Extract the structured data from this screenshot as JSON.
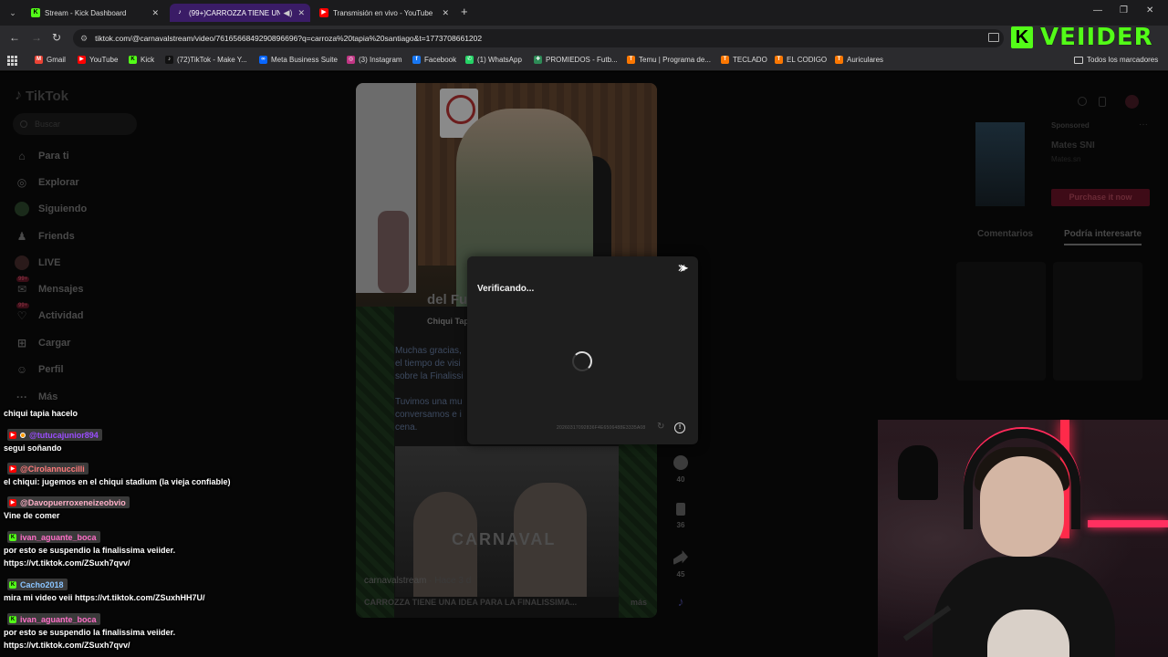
{
  "browser": {
    "tabs": [
      {
        "title": "Stream - Kick Dashboard",
        "favicon": "K",
        "color": "#53fc18",
        "active": false
      },
      {
        "title": "(99+)CARROZZA TIENE UNA",
        "favicon": "♪",
        "color": "#000000",
        "active": true
      },
      {
        "title": "Transmisión en vivo - YouTube",
        "favicon": "▶",
        "color": "#ff0000",
        "active": false
      }
    ],
    "url": "tiktok.com/@carnavalstream/video/7616566849290896696?q=carroza%20tapia%20santiago&t=1773708661202",
    "bookmarks": [
      {
        "label": "Gmail",
        "icon": "M",
        "color": "#ea4335"
      },
      {
        "label": "YouTube",
        "icon": "▶",
        "color": "#ff0000"
      },
      {
        "label": "Kick",
        "icon": "K",
        "color": "#53fc18"
      },
      {
        "label": "(72)TikTok - Make Y...",
        "icon": "♪",
        "color": "#111111"
      },
      {
        "label": "Meta Business Suite",
        "icon": "∞",
        "color": "#0866ff"
      },
      {
        "label": "(3) Instagram",
        "icon": "◎",
        "color": "#c13584"
      },
      {
        "label": "Facebook",
        "icon": "f",
        "color": "#1877f2"
      },
      {
        "label": "(1) WhatsApp",
        "icon": "✆",
        "color": "#25d366"
      },
      {
        "label": "PROMIEDOS - Futb...",
        "icon": "✚",
        "color": "#2e8b57"
      },
      {
        "label": "Temu | Programa de...",
        "icon": "T",
        "color": "#fb7701"
      },
      {
        "label": "TECLADO",
        "icon": "T",
        "color": "#fb7701"
      },
      {
        "label": "EL CODIGO",
        "icon": "T",
        "color": "#fb7701"
      },
      {
        "label": "Auriculares",
        "icon": "T",
        "color": "#fb7701"
      }
    ],
    "all_bookmarks": "Todos los marcadores"
  },
  "tiktok": {
    "logo": "TikTok",
    "search_placeholder": "Buscar",
    "nav": [
      {
        "label": "Para ti",
        "icon": "home-icon"
      },
      {
        "label": "Explorar",
        "icon": "compass-icon"
      },
      {
        "label": "Siguiendo",
        "icon": "following-icon"
      },
      {
        "label": "Friends",
        "icon": "friends-icon"
      },
      {
        "label": "LIVE",
        "icon": "live-icon"
      },
      {
        "label": "Mensajes",
        "icon": "messages-icon",
        "badge": "99+"
      },
      {
        "label": "Actividad",
        "icon": "activity-icon",
        "badge": "99+"
      },
      {
        "label": "Cargar",
        "icon": "upload-icon"
      },
      {
        "label": "Perfil",
        "icon": "profile-icon"
      },
      {
        "label": "Más",
        "icon": "more-icon"
      }
    ],
    "video": {
      "brand_strip": "del Fu",
      "card_author": "Chiqui Tap",
      "card_lines": [
        "Muchas gracias,",
        "el tiempo de visi",
        "sobre la Finalissi",
        "",
        "Tuvimos una mu",
        "conversamos e i",
        "cena."
      ],
      "watermark": "CARNAVAL",
      "author": "carnavalstream",
      "ago": "Hace 3 d",
      "caption": "CARROZZA TIENE UNA IDEA PARA LA FINALISSIMA...",
      "more": "más"
    },
    "actions": [
      {
        "icon": "comment-icon",
        "count": "40"
      },
      {
        "icon": "save-icon",
        "count": "36"
      },
      {
        "icon": "share-icon",
        "count": "45"
      }
    ],
    "ad": {
      "sponsored": "Sponsored",
      "title": "Mates SNI",
      "sub": "Mates.sn",
      "cta": "Purchase it now"
    },
    "tabs": [
      "Comentarios",
      "Podría interesarte"
    ]
  },
  "captcha": {
    "title": "Verificando...",
    "token": "20260317092836F4E6506488E3335A08"
  },
  "chat": [
    {
      "type": "msg",
      "text": "chiqui tapia hacelo"
    },
    {
      "type": "user",
      "name": "@tutucajunior894",
      "badge": "yt",
      "color": "#9b4dff"
    },
    {
      "type": "msg",
      "text": "segui soñando"
    },
    {
      "type": "user",
      "name": "@Cirolannuccilli",
      "badge": "yt",
      "color": "#ff6b6b"
    },
    {
      "type": "msg",
      "text": "el chiqui: jugemos en el chiqui stadium (la vieja confiable)"
    },
    {
      "type": "user",
      "name": "@Davopuerroxeneizeobvio",
      "badge": "yt",
      "color": "#ff8fb0"
    },
    {
      "type": "msg",
      "text": "Vine de comer"
    },
    {
      "type": "user",
      "name": "ivan_aguante_boca",
      "badge": "kick",
      "color": "#ff5fbf"
    },
    {
      "type": "msg",
      "text": "por esto se suspendio la finalissima veiider."
    },
    {
      "type": "msg",
      "text": "https://vt.tiktok.com/ZSuxh7qvv/"
    },
    {
      "type": "user",
      "name": "Cacho2018",
      "badge": "kick",
      "color": "#7ab8ff"
    },
    {
      "type": "msg",
      "text": "mira mi video veii https://vt.tiktok.com/ZSuxhHH7U/"
    },
    {
      "type": "user",
      "name": "ivan_aguante_boca",
      "badge": "kick",
      "color": "#ff5fbf"
    },
    {
      "type": "msg",
      "text": "por esto se suspendio la finalissima veiider."
    },
    {
      "type": "msg",
      "text": "https://vt.tiktok.com/ZSuxh7qvv/"
    }
  ],
  "streamer_logo": {
    "letter": "K",
    "name": "VEIIDER",
    "color": "#53fc18"
  }
}
